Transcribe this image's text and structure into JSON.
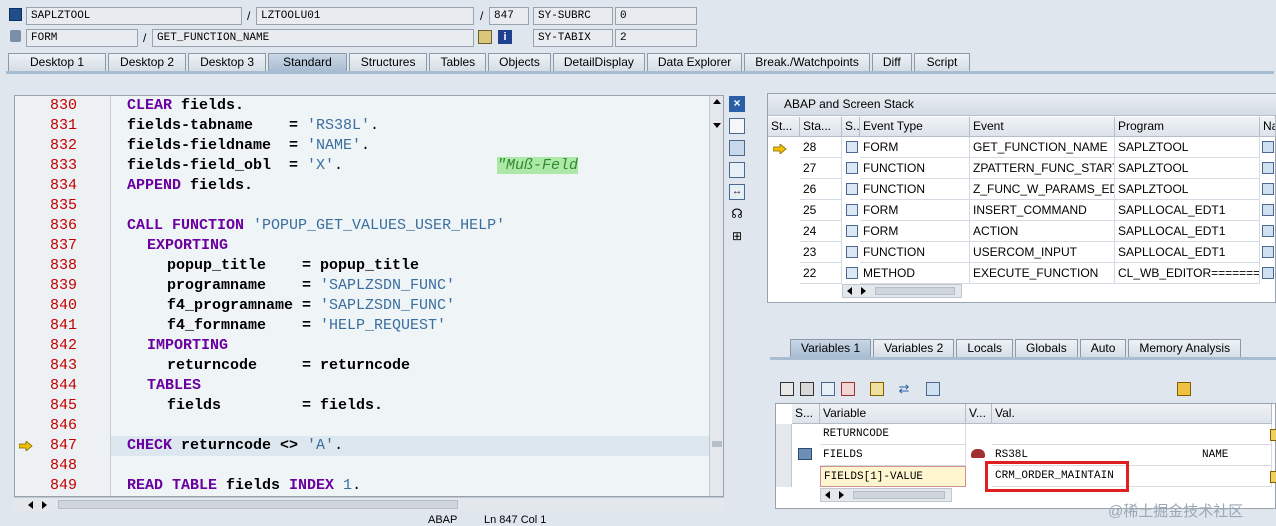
{
  "header": {
    "program": "SAPLZTOOL",
    "include": "LZTOOLU01",
    "line": "847",
    "sysubrc_label": "SY-SUBRC",
    "sysubrc_value": "0",
    "event_type": "FORM",
    "event": "GET_FUNCTION_NAME",
    "sytabix_label": "SY-TABIX",
    "sytabix_value": "2",
    "slash": "/"
  },
  "tabs": [
    {
      "label": "Desktop 1"
    },
    {
      "label": "Desktop 2"
    },
    {
      "label": "Desktop 3"
    },
    {
      "label": "Standard"
    },
    {
      "label": "Structures"
    },
    {
      "label": "Tables"
    },
    {
      "label": "Objects"
    },
    {
      "label": "DetailDisplay"
    },
    {
      "label": "Data Explorer"
    },
    {
      "label": "Break./Watchpoints"
    },
    {
      "label": "Diff"
    },
    {
      "label": "Script"
    }
  ],
  "code": {
    "lines": [
      {
        "n": "830"
      },
      {
        "n": "831"
      },
      {
        "n": "832"
      },
      {
        "n": "833"
      },
      {
        "n": "834"
      },
      {
        "n": "835"
      },
      {
        "n": "836"
      },
      {
        "n": "837"
      },
      {
        "n": "838"
      },
      {
        "n": "839"
      },
      {
        "n": "840"
      },
      {
        "n": "841"
      },
      {
        "n": "842"
      },
      {
        "n": "843"
      },
      {
        "n": "844"
      },
      {
        "n": "845"
      },
      {
        "n": "846"
      },
      {
        "n": "847"
      },
      {
        "n": "848"
      },
      {
        "n": "849"
      }
    ],
    "t830a": "CLEAR",
    "t830b": " fields.",
    "t831": "fields-tabname    = ",
    "s831": "'RS38L'",
    "e831": ".",
    "t832": "fields-fieldname  = ",
    "s832": "'NAME'",
    "e832": ".",
    "t833": "fields-field_obl  = ",
    "s833": "'X'",
    "e833": ".",
    "c833": "\"Muß-Feld",
    "t834a": "APPEND",
    "t834b": " fields.",
    "t836a": "CALL FUNCTION",
    "s836": " 'POPUP_GET_VALUES_USER_HELP'",
    "t837": "EXPORTING",
    "t838": "popup_title    = popup_title",
    "t839": "programname    = ",
    "s839": "'SAPLZSDN_FUNC'",
    "t840": "f4_programname = ",
    "s840": "'SAPLZSDN_FUNC'",
    "t841": "f4_formname    = ",
    "s841": "'HELP_REQUEST'",
    "t842": "IMPORTING",
    "t843": "returncode     = returncode",
    "t844": "TABLES",
    "t845": "fields         = fields.",
    "t847a": "CHECK",
    "t847b": " returncode <> ",
    "s847": "'A'",
    "e847": ".",
    "t849a": "READ TABLE",
    "t849b": " fields ",
    "t849c": "INDEX",
    "s849": " 1",
    "e849": "."
  },
  "status_bar": {
    "lang": "ABAP",
    "pos": "Ln 847 Col 1"
  },
  "stack": {
    "title": "ABAP and Screen Stack",
    "headers": [
      "St...",
      "Sta...",
      "S...",
      "Event Type",
      "Event",
      "Program",
      "Na"
    ],
    "rows": [
      {
        "level": "28",
        "type": "FORM",
        "event": "GET_FUNCTION_NAME",
        "program": "SAPLZTOOL"
      },
      {
        "level": "27",
        "type": "FUNCTION",
        "event": "ZPATTERN_FUNC_START",
        "program": "SAPLZTOOL"
      },
      {
        "level": "26",
        "type": "FUNCTION",
        "event": "Z_FUNC_W_PARAMS_ED...",
        "program": "SAPLZTOOL"
      },
      {
        "level": "25",
        "type": "FORM",
        "event": "INSERT_COMMAND",
        "program": "SAPLLOCAL_EDT1"
      },
      {
        "level": "24",
        "type": "FORM",
        "event": "ACTION",
        "program": "SAPLLOCAL_EDT1"
      },
      {
        "level": "23",
        "type": "FUNCTION",
        "event": "USERCOM_INPUT",
        "program": "SAPLLOCAL_EDT1"
      },
      {
        "level": "22",
        "type": "METHOD",
        "event": "EXECUTE_FUNCTION",
        "program": "CL_WB_EDITOR======="
      }
    ]
  },
  "var_tabs": [
    {
      "label": "Variables 1"
    },
    {
      "label": "Variables 2"
    },
    {
      "label": "Locals"
    },
    {
      "label": "Globals"
    },
    {
      "label": "Auto"
    },
    {
      "label": "Memory Analysis"
    }
  ],
  "vars": {
    "headers": [
      "S...",
      "Variable",
      "V...",
      "Val."
    ],
    "rows": [
      {
        "name": "RETURNCODE",
        "value": ""
      },
      {
        "name": "FIELDS",
        "value": "RS38L",
        "extra": "NAME"
      },
      {
        "name": "FIELDS[1]-VALUE",
        "value": "CRM_ORDER_MAINTAIN"
      }
    ]
  },
  "watermark": "@稀土掘金技术社区",
  "colors": {
    "keyword": "#6a00a0",
    "string": "#3a6e9e",
    "linenum": "#c00000",
    "highlight": "#e02020"
  }
}
